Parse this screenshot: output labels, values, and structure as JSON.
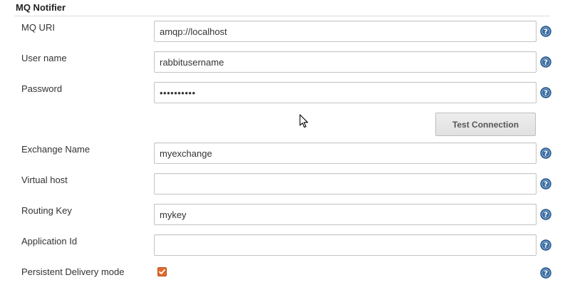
{
  "section": {
    "title": "MQ Notifier"
  },
  "fields": {
    "mq_uri": {
      "label": "MQ URI",
      "value": "amqp://localhost"
    },
    "user_name": {
      "label": "User name",
      "value": "rabbitusername"
    },
    "password": {
      "label": "Password",
      "value": "••••••••••"
    },
    "exchange_name": {
      "label": "Exchange Name",
      "value": "myexchange"
    },
    "virtual_host": {
      "label": "Virtual host",
      "value": ""
    },
    "routing_key": {
      "label": "Routing Key",
      "value": "mykey"
    },
    "application_id": {
      "label": "Application Id",
      "value": ""
    },
    "persistent_delivery": {
      "label": "Persistent Delivery mode",
      "checked": true
    }
  },
  "buttons": {
    "test_connection": "Test Connection"
  },
  "icons": {
    "help": "help-icon",
    "checkbox": "checkbox-checked-icon",
    "cursor": "mouse-pointer-icon"
  },
  "colors": {
    "help_icon": "#3a6ea5",
    "checkbox_accent": "#e06a2e",
    "input_border": "#c4c4c4",
    "button_bg": "#e6e6e6"
  }
}
